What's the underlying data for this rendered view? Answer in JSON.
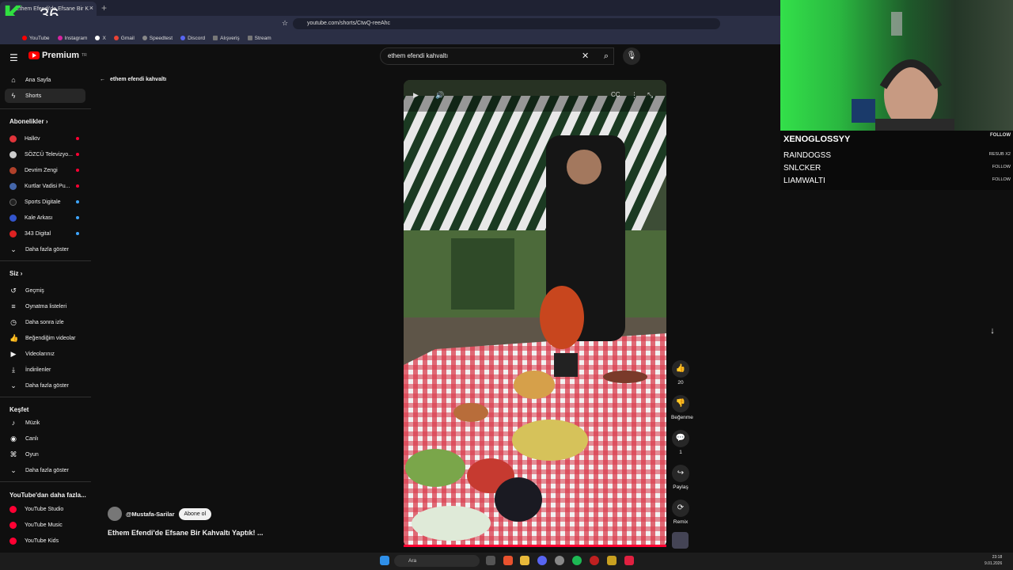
{
  "browser": {
    "tab_title": "Ethem Efendi'de Efsane Bir K",
    "url": "youtube.com/shorts/CtwQ-reeAhc",
    "bookmarks": [
      "YouTube",
      "Instagram",
      "X",
      "Gmail",
      "Speedtest",
      "Discord",
      "Alışveriş",
      "Stream"
    ]
  },
  "overlay_logo": {
    "number": "36"
  },
  "header": {
    "brand": "Premium",
    "brand_sup": "TR",
    "search_value": "ethem efendi kahvaltı"
  },
  "sidebar": {
    "main": [
      {
        "label": "Ana Sayfa",
        "icon": "home-icon"
      },
      {
        "label": "Shorts",
        "icon": "shorts-icon"
      }
    ],
    "subs_header": "Abonelikler",
    "subs": [
      {
        "label": "Halktv",
        "color": "#e0343a",
        "live": "#ff0033"
      },
      {
        "label": "SÖZCÜ Televizyo...",
        "color": "#cccccc",
        "live": "#ff0033"
      },
      {
        "label": "Devrim Zengi",
        "color": "#b0402a",
        "live": "#ff0033"
      },
      {
        "label": "Kurtlar Vadisi Pu...",
        "color": "#4466aa",
        "live": "#ff0033"
      },
      {
        "label": "Sports Digitale",
        "color": "#222222",
        "live": "#3ea6ff"
      },
      {
        "label": "Kale Arkası",
        "color": "#3355cc",
        "live": "#3ea6ff"
      },
      {
        "label": "343 Digital",
        "color": "#dd2222",
        "live": "#3ea6ff"
      }
    ],
    "subs_more": "Daha fazla göster",
    "you_header": "Siz",
    "you": [
      {
        "label": "Geçmiş",
        "icon": "history-icon"
      },
      {
        "label": "Oynatma listeleri",
        "icon": "playlist-icon"
      },
      {
        "label": "Daha sonra izle",
        "icon": "clock-icon"
      },
      {
        "label": "Beğendiğim videolar",
        "icon": "like-icon"
      },
      {
        "label": "Videolarınız",
        "icon": "video-icon"
      },
      {
        "label": "İndirilenler",
        "icon": "download-icon"
      },
      {
        "label": "Daha fazla göster",
        "icon": "chevron-down-icon"
      }
    ],
    "explore_header": "Keşfet",
    "explore": [
      {
        "label": "Müzik",
        "icon": "music-icon"
      },
      {
        "label": "Canlı",
        "icon": "live-icon"
      },
      {
        "label": "Oyun",
        "icon": "game-icon"
      },
      {
        "label": "Daha fazla göster",
        "icon": "chevron-down-icon"
      }
    ],
    "more_header": "YouTube'dan daha fazla...",
    "more": [
      {
        "label": "YouTube Studio"
      },
      {
        "label": "YouTube Music"
      },
      {
        "label": "YouTube Kids"
      }
    ]
  },
  "back_label": "ethem efendi kahvaltı",
  "actions": {
    "likes": "20",
    "dislike": "Beğenme",
    "comments": "1",
    "share": "Paylaş",
    "remix": "Remix"
  },
  "video_meta": {
    "channel": "@Mustafa-Sarilar",
    "subscribe": "Abone ol",
    "title": "Ethem Efendi'de Efsane Bir Kahvaltı Yaptık! ..."
  },
  "stream": {
    "top_follower": "XENOGLOSSYY",
    "top_tag": "FOLLOW",
    "followers": [
      {
        "name": "RAINDOGSS",
        "tag": "RESUB X2"
      },
      {
        "name": "SNLCKER",
        "tag": "FOLLOW"
      },
      {
        "name": "LIAMWALTI",
        "tag": "FOLLOW"
      }
    ]
  },
  "taskbar": {
    "search": "Ara",
    "time": "23:18",
    "date": "9.01.2026"
  }
}
